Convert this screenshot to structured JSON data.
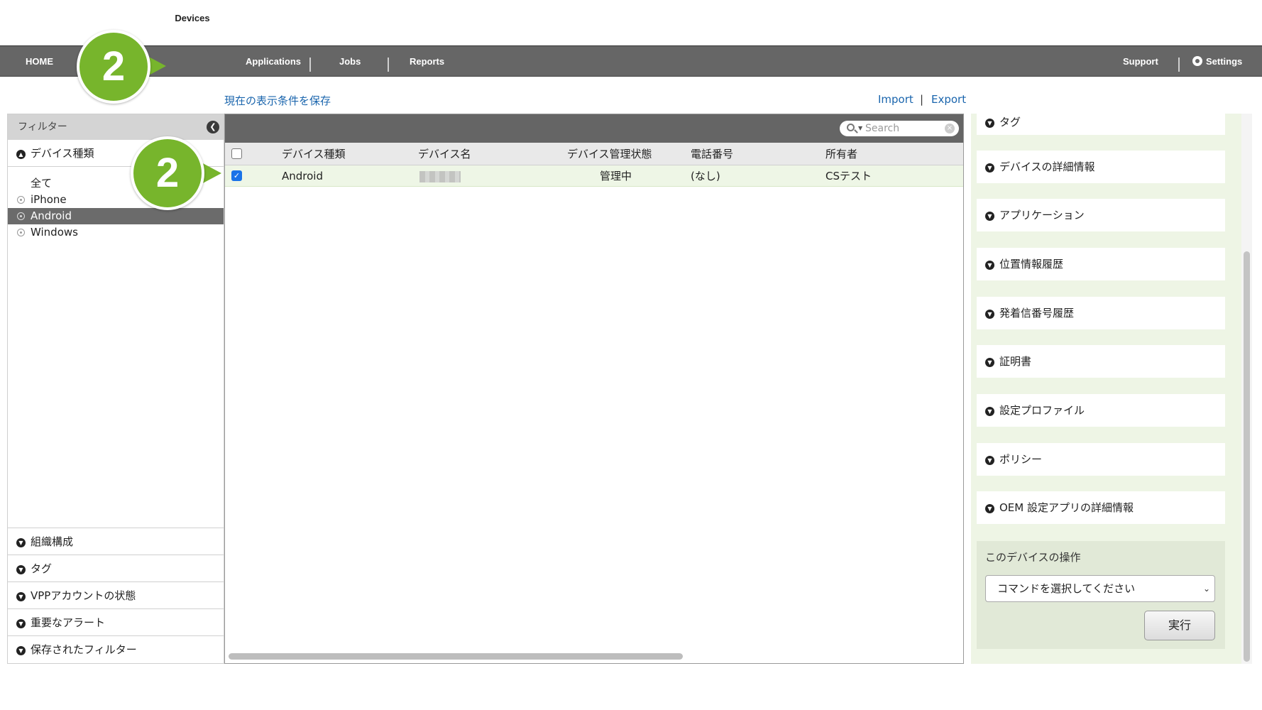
{
  "nav": {
    "home": "HOME",
    "devices": "Devices",
    "applications": "Applications",
    "jobs": "Jobs",
    "reports": "Reports",
    "support": "Support",
    "settings": "Settings"
  },
  "toolbar": {
    "save_view": "現在の表示条件を保存",
    "import": "Import",
    "separator": "|",
    "export": "Export"
  },
  "sidebar": {
    "header": "フィルター",
    "device_type_section": "デバイス種類",
    "items": [
      {
        "label": "全て"
      },
      {
        "label": "iPhone"
      },
      {
        "label": "Android"
      },
      {
        "label": "Windows"
      }
    ],
    "bottom_sections": [
      "組織構成",
      "タグ",
      "VPPアカウントの状態",
      "重要なアラート",
      "保存されたフィルター"
    ]
  },
  "table": {
    "search_placeholder": "Search",
    "columns": [
      "デバイス種類",
      "デバイス名",
      "デバイス管理状態",
      "電話番号",
      "所有者"
    ],
    "rows": [
      {
        "type": "Android",
        "name": "",
        "status": "管理中",
        "phone": "(なし)",
        "owner": "CSテスト",
        "checked": true
      }
    ]
  },
  "right_panel": {
    "sections": [
      "タグ",
      "デバイスの詳細情報",
      "アプリケーション",
      "位置情報履歴",
      "発着信番号履歴",
      "証明書",
      "設定プロファイル",
      "ポリシー",
      "OEM 設定アプリの詳細情報"
    ],
    "ops_title": "このデバイスの操作",
    "select_value": "コマンドを選択してください",
    "run_button": "実行"
  },
  "callouts": [
    "2",
    "2"
  ],
  "colors": {
    "nav_bg": "#666666",
    "link": "#1a65ad",
    "badge": "#77b52c",
    "selected_row": "#eef6e6",
    "right_panel_bg": "#eef5e5"
  }
}
